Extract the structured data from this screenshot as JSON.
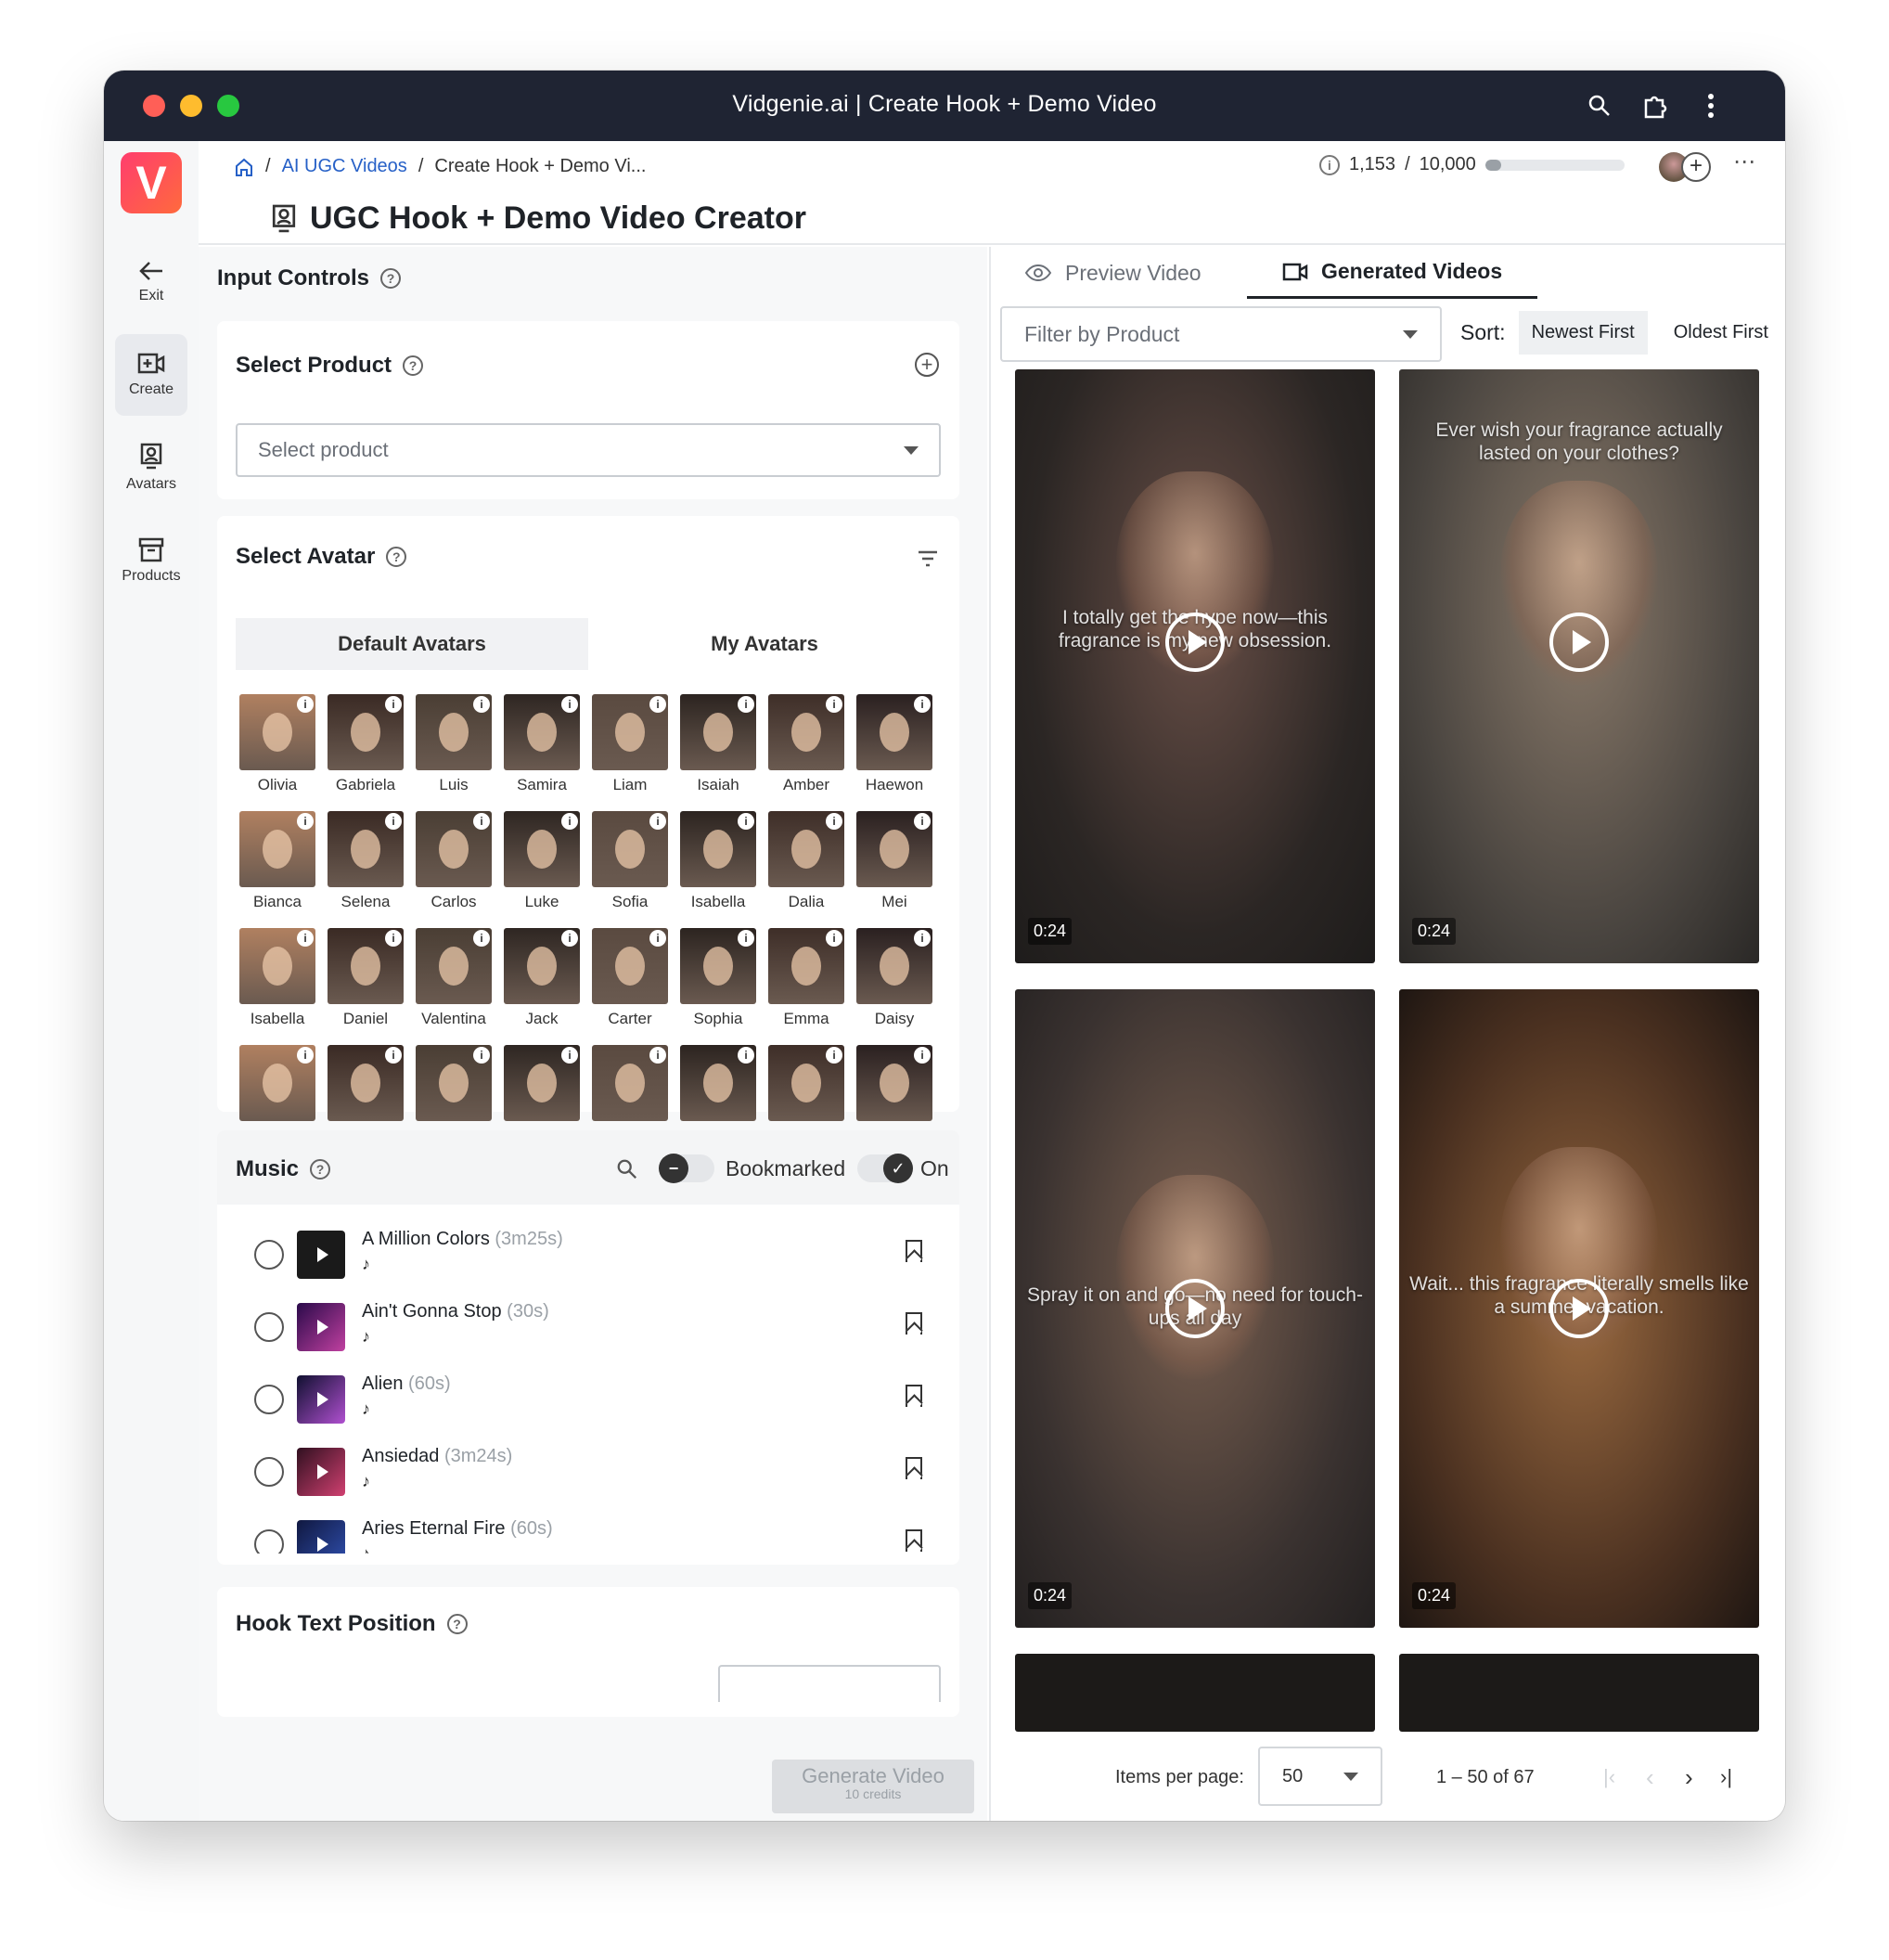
{
  "window": {
    "title": "Vidgenie.ai | Create Hook + Demo Video"
  },
  "sidebar": {
    "logo": "V",
    "items": [
      {
        "label": "Exit"
      },
      {
        "label": "Create"
      },
      {
        "label": "Avatars"
      },
      {
        "label": "Products"
      }
    ]
  },
  "breadcrumb": {
    "link": "AI UGC Videos",
    "separator": "/",
    "current": "Create Hook + Demo Vi..."
  },
  "credits": {
    "used": "1,153",
    "sep": "/",
    "total": "10,000",
    "fraction": 0.115
  },
  "page_title": "UGC Hook + Demo Video Creator",
  "input_controls": {
    "title": "Input Controls",
    "select_product": {
      "title": "Select Product",
      "placeholder": "Select product"
    },
    "select_avatar": {
      "title": "Select Avatar",
      "tabs": [
        "Default Avatars",
        "My Avatars"
      ],
      "avatars": [
        "Olivia",
        "Gabriela",
        "Luis",
        "Samira",
        "Liam",
        "Isaiah",
        "Amber",
        "Haewon",
        "Bianca",
        "Selena",
        "Carlos",
        "Luke",
        "Sofia",
        "Isabella",
        "Dalia",
        "Mei",
        "Isabella",
        "Daniel",
        "Valentina",
        "Jack",
        "Carter",
        "Sophia",
        "Emma",
        "Daisy"
      ],
      "extra_row_count": 8
    },
    "music": {
      "title": "Music",
      "bookmarked_label": "Bookmarked",
      "on_label": "On",
      "tracks": [
        {
          "name": "A Million Colors",
          "duration": "(3m25s)"
        },
        {
          "name": "Ain't Gonna Stop",
          "duration": "(30s)"
        },
        {
          "name": "Alien",
          "duration": "(60s)"
        },
        {
          "name": "Ansiedad",
          "duration": "(3m24s)"
        },
        {
          "name": "Aries Eternal Fire",
          "duration": "(60s)"
        }
      ]
    },
    "hook_text_position": {
      "title": "Hook Text Position"
    },
    "generate": {
      "label": "Generate Video",
      "sub": "10 credits"
    }
  },
  "right": {
    "tabs": [
      "Preview Video",
      "Generated Videos"
    ],
    "filter_placeholder": "Filter by Product",
    "sort_label": "Sort:",
    "sort_options": [
      "Newest First",
      "Oldest First"
    ],
    "videos": [
      {
        "caption": "I totally get the hype now—this fragrance is my new obsession.",
        "duration": "0:24"
      },
      {
        "caption": "Ever wish your fragrance actually lasted on your clothes?",
        "duration": "0:24"
      },
      {
        "caption": "Spray it on and go—no need for touch-ups all day",
        "duration": "0:24"
      },
      {
        "caption": "Wait... this fragrance literally smells like a summer vacation.",
        "duration": "0:24"
      }
    ],
    "pagination": {
      "items_per_page_label": "Items per page:",
      "per_page": "50",
      "range": "1 – 50 of 67"
    }
  }
}
